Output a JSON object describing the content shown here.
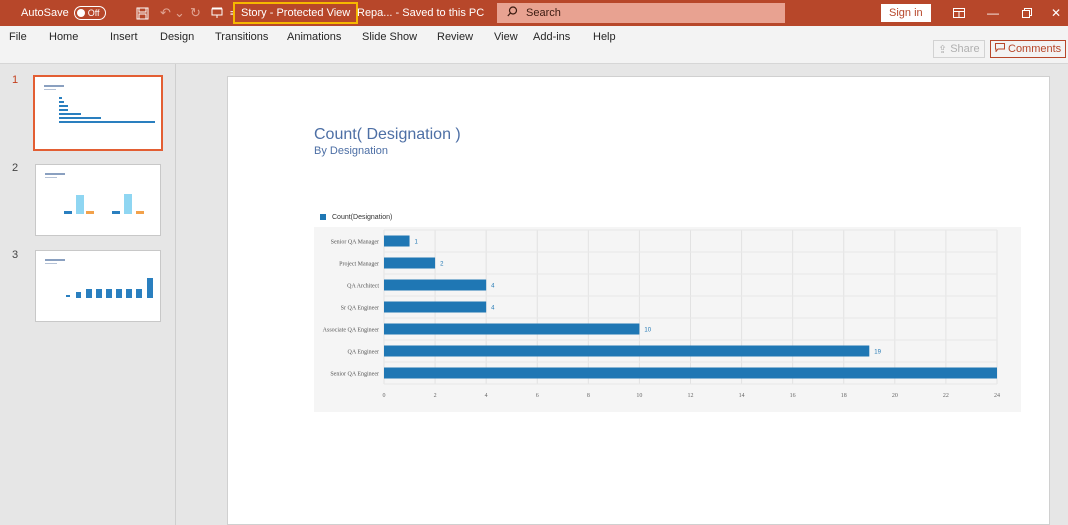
{
  "titlebar": {
    "autosave_label": "AutoSave",
    "autosave_state": "Off",
    "doc_title": "Story  -  Protected View",
    "save_status": "Repa...  -  Saved to this PC",
    "search_placeholder": "Search",
    "signin_label": "Sign in",
    "accent_color": "#b7472a"
  },
  "menubar": {
    "tabs": [
      "File",
      "Home",
      "Insert",
      "Design",
      "Transitions",
      "Animations",
      "Slide Show",
      "Review",
      "View",
      "Add-ins",
      "Help"
    ],
    "share_label": "Share",
    "comments_label": "Comments"
  },
  "thumbnails": {
    "numbers": [
      "1",
      "2",
      "3"
    ],
    "active": 1
  },
  "slide": {
    "title": "Count( Designation )",
    "subtitle": "By Designation"
  },
  "chart_data": {
    "type": "bar",
    "orientation": "horizontal",
    "legend": "Count(Designation)",
    "categories": [
      "Senior QA Manager",
      "Project Manager",
      "QA Architect",
      "Sr QA Engineer",
      "Associate QA Engineer",
      "QA Engineer",
      "Senior QA Engineer"
    ],
    "values": [
      1,
      2,
      4,
      4,
      10,
      19,
      24
    ],
    "value_labels": [
      "1",
      "2",
      "4",
      "4",
      "10",
      "19",
      ""
    ],
    "x_ticks": [
      0,
      2,
      4,
      6,
      8,
      10,
      12,
      14,
      16,
      18,
      20,
      22,
      24
    ],
    "xlim": [
      0,
      24
    ],
    "bar_color": "#1f77b4",
    "grid": true
  }
}
